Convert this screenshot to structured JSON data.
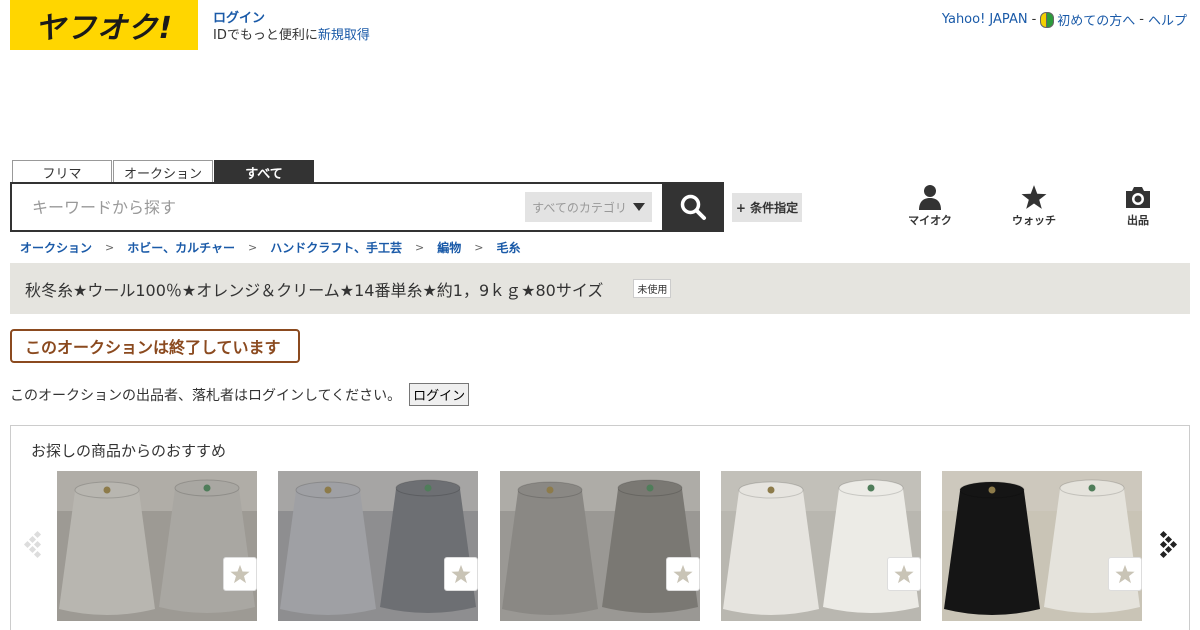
{
  "header": {
    "logo": "ヤフオク!",
    "login_label": "ログイン",
    "id_text": "IDでもっと便利に",
    "signup_label": "新規取得",
    "yahoo_japan": "Yahoo! JAPAN",
    "sep1": "-",
    "beginner": "初めての方へ",
    "sep2": "-",
    "help": "ヘルプ"
  },
  "tabs": [
    "フリマ",
    "オークション",
    "すべて"
  ],
  "search": {
    "placeholder": "キーワードから探す",
    "category": "すべてのカテゴリ",
    "detail": "+ 条件指定"
  },
  "nav": {
    "mine": "マイオク",
    "watch": "ウォッチ",
    "sell": "出品"
  },
  "breadcrumb": [
    "オークション",
    "ホビー、カルチャー",
    "ハンドクラフト、手工芸",
    "編物",
    "毛糸"
  ],
  "breadcrumb_sep": ">",
  "item": {
    "title": "秋冬糸★ウール100％★オレンジ＆クリーム★14番単糸★約1，9ｋｇ★80サイズ",
    "condition": "未使用"
  },
  "ended_message": "このオークションは終了しています",
  "login_message": "このオークションの出品者、落札者はログインしてください。",
  "login_button": "ログイン",
  "recommend": {
    "heading": "お探しの商品からのおすすめ",
    "items": [
      {
        "colors": [
          "#b8b6b0",
          "#a9a7a2"
        ],
        "bg": "#9d9a94"
      },
      {
        "colors": [
          "#9fa0a4",
          "#6d6f73"
        ],
        "bg": "#8e8e90"
      },
      {
        "colors": [
          "#8a8884",
          "#7a7873"
        ],
        "bg": "#9a9894"
      },
      {
        "colors": [
          "#e6e4df",
          "#ecebe6"
        ],
        "bg": "#b9b7b0"
      },
      {
        "colors": [
          "#151515",
          "#e5e3dc"
        ],
        "bg": "#c9c4b6"
      }
    ]
  }
}
